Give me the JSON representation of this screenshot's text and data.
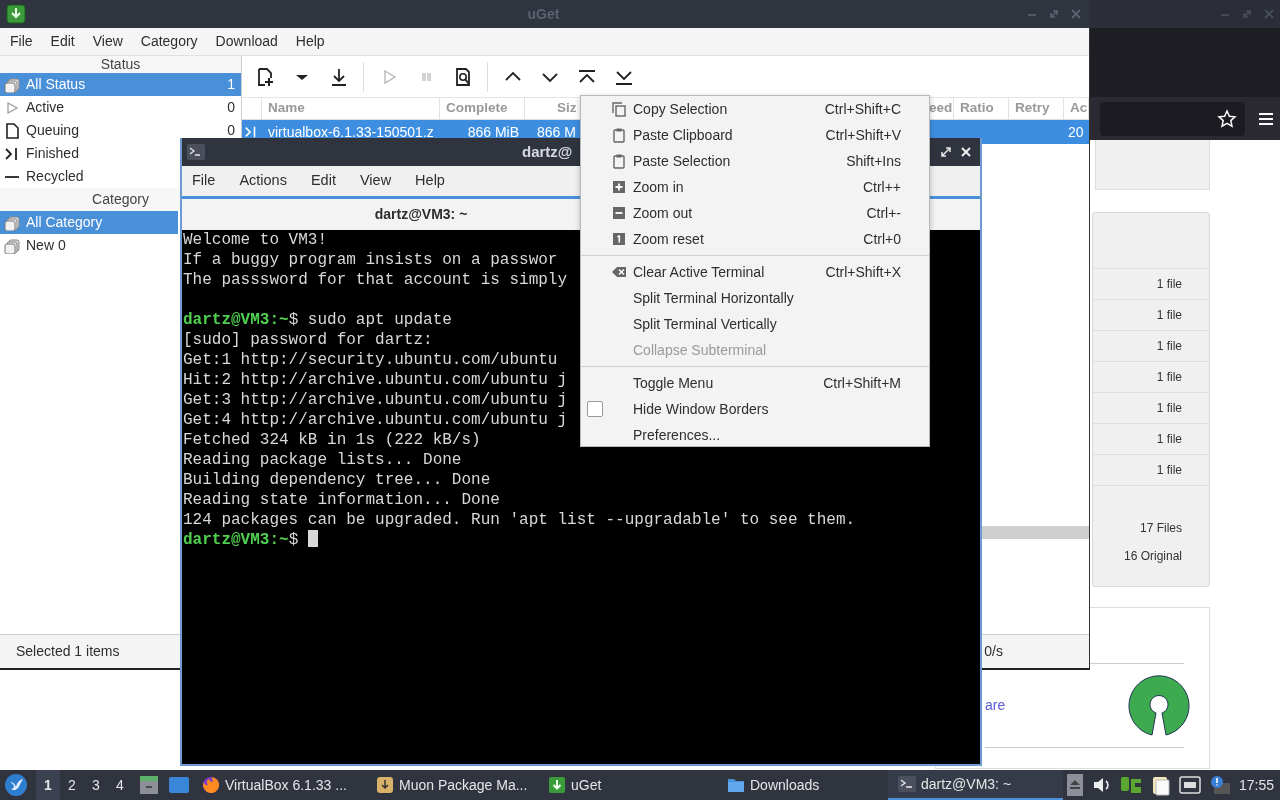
{
  "uget": {
    "title": "uGet",
    "menu": [
      "File",
      "Edit",
      "View",
      "Category",
      "Download",
      "Help"
    ],
    "status_header": "Status",
    "status_items": [
      {
        "label": "All Status",
        "count": "1",
        "selected": true
      },
      {
        "label": "Active",
        "count": "0",
        "selected": false
      },
      {
        "label": "Queuing",
        "count": "0",
        "selected": false
      },
      {
        "label": "Finished",
        "selected": false
      },
      {
        "label": "Recycled",
        "selected": false
      }
    ],
    "category_header": "Category",
    "category_items": [
      {
        "label": "All Category",
        "selected": true
      },
      {
        "label": "New 0",
        "selected": false
      }
    ],
    "toolbar": [
      {
        "disabled": false
      },
      {
        "disabled": false
      },
      {
        "disabled": false
      },
      {
        "disabled": true
      },
      {
        "disabled": true
      },
      {
        "disabled": false
      },
      {
        "disabled": false
      },
      {
        "disabled": false
      },
      {
        "disabled": false
      },
      {
        "disabled": false
      }
    ],
    "table": {
      "columns": [
        "Name",
        "Complete",
        "Siz",
        "eed",
        "Ratio",
        "Retry",
        "Ac"
      ],
      "rows": [
        {
          "selected": true,
          "name": "virtualbox-6.1.33-150501.z",
          "complete": "866 MiB",
          "size": "866 M",
          "added": "20"
        }
      ]
    },
    "status_bar": {
      "selection": "Selected 1 items",
      "speed": "0/s"
    }
  },
  "terminal": {
    "title": "dartz@",
    "menu": [
      "File",
      "Actions",
      "Edit",
      "View",
      "Help"
    ],
    "tab": {
      "label": "dartz@VM3: ~",
      "selected": true
    },
    "lines": [
      {
        "kind": "output",
        "text": "Welcome to VM3!"
      },
      {
        "kind": "output",
        "text": "If a buggy program insists on a passwor"
      },
      {
        "kind": "output",
        "text": "The passsword for that account is simply"
      },
      {
        "kind": "blank"
      },
      {
        "kind": "prompt",
        "prompt": "dartz@VM3:~",
        "text": "$ sudo apt update"
      },
      {
        "kind": "output",
        "text": "[sudo] password for dartz:"
      },
      {
        "kind": "output",
        "text": "Get:1 http://security.ubuntu.com/ubuntu"
      },
      {
        "kind": "output",
        "text": "Hit:2 http://archive.ubuntu.com/ubuntu j"
      },
      {
        "kind": "output",
        "text": "Get:3 http://archive.ubuntu.com/ubuntu j"
      },
      {
        "kind": "output",
        "text": "Get:4 http://archive.ubuntu.com/ubuntu j"
      },
      {
        "kind": "output",
        "text": "Fetched 324 kB in 1s (222 kB/s)"
      },
      {
        "kind": "output",
        "text": "Reading package lists... Done"
      },
      {
        "kind": "output",
        "text": "Building dependency tree... Done"
      },
      {
        "kind": "output",
        "text": "Reading state information... Done"
      },
      {
        "kind": "output",
        "text": "124 packages can be upgraded. Run 'apt list --upgradable' to see them."
      },
      {
        "kind": "prompt",
        "prompt": "dartz@VM3:~",
        "text": "$",
        "cursor": true
      }
    ]
  },
  "context_menu": {
    "items": [
      {
        "kind": "item",
        "label": "Copy Selection",
        "shortcut": "Ctrl+Shift+C",
        "disabled": false
      },
      {
        "kind": "item",
        "label": "Paste Clipboard",
        "shortcut": "Ctrl+Shift+V",
        "disabled": false
      },
      {
        "kind": "item",
        "label": "Paste Selection",
        "shortcut": "Shift+Ins",
        "disabled": false
      },
      {
        "kind": "item",
        "label": "Zoom in",
        "shortcut": "Ctrl++",
        "disabled": false
      },
      {
        "kind": "item",
        "label": "Zoom out",
        "shortcut": "Ctrl+-",
        "disabled": false
      },
      {
        "kind": "item",
        "label": "Zoom reset",
        "shortcut": "Ctrl+0",
        "disabled": false
      },
      {
        "kind": "separator"
      },
      {
        "kind": "item",
        "label": "Clear Active Terminal",
        "shortcut": "Ctrl+Shift+X",
        "disabled": false
      },
      {
        "kind": "item",
        "label": "Split Terminal Horizontally",
        "disabled": false
      },
      {
        "kind": "item",
        "label": "Split Terminal Vertically",
        "disabled": false
      },
      {
        "kind": "item",
        "label": "Collapse Subterminal",
        "disabled": true
      },
      {
        "kind": "separator"
      },
      {
        "kind": "item",
        "label": "Toggle Menu",
        "shortcut": "Ctrl+Shift+M",
        "disabled": false
      },
      {
        "kind": "check",
        "label": "Hide Window Borders",
        "checked": false
      },
      {
        "kind": "item",
        "label": "Preferences...",
        "disabled": false
      }
    ]
  },
  "browser": {
    "file_counts": [
      "1 file",
      "1 file",
      "1 file",
      "1 file",
      "1 file",
      "1 file",
      "1 file"
    ],
    "total": "17 Files",
    "original": "16 Original",
    "link": "are"
  },
  "taskbar": {
    "workspaces": [
      {
        "label": "1",
        "selected": true
      },
      {
        "label": "2",
        "selected": false
      },
      {
        "label": "3",
        "selected": false
      },
      {
        "label": "4",
        "selected": false
      }
    ],
    "tasks": [
      {
        "label": "VirtualBox 6.1.33 ...",
        "selected": false
      },
      {
        "label": "Muon Package Ma...",
        "selected": false
      },
      {
        "label": "uGet",
        "selected": false
      },
      {
        "label": "Downloads",
        "selected": false
      },
      {
        "label": "dartz@VM3: ~",
        "selected": true
      }
    ],
    "clock": "17:55"
  }
}
